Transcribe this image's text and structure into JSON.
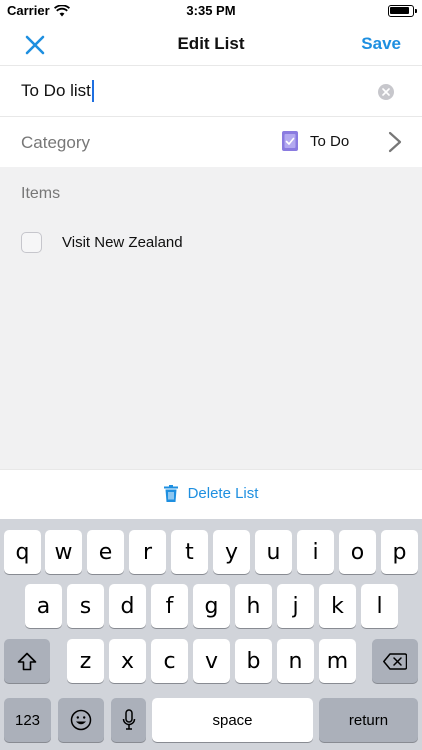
{
  "status_bar": {
    "carrier": "Carrier",
    "time": "3:35 PM"
  },
  "nav": {
    "title": "Edit List",
    "save_label": "Save"
  },
  "name_field": {
    "value": "To Do list"
  },
  "category": {
    "label": "Category",
    "value": "To Do"
  },
  "items": {
    "heading": "Items",
    "list": [
      {
        "label": "Visit New Zealand",
        "checked": false
      }
    ]
  },
  "delete_label": "Delete List",
  "keyboard": {
    "row1": [
      "q",
      "w",
      "e",
      "r",
      "t",
      "y",
      "u",
      "i",
      "o",
      "p"
    ],
    "row2": [
      "a",
      "s",
      "d",
      "f",
      "g",
      "h",
      "j",
      "k",
      "l"
    ],
    "row3": [
      "z",
      "x",
      "c",
      "v",
      "b",
      "n",
      "m"
    ],
    "numbers_label": "123",
    "space_label": "space",
    "return_label": "return"
  },
  "colors": {
    "accent": "#1e8fe0",
    "category_icon": "#8a7be0",
    "background_gray": "#f1f1f2"
  }
}
